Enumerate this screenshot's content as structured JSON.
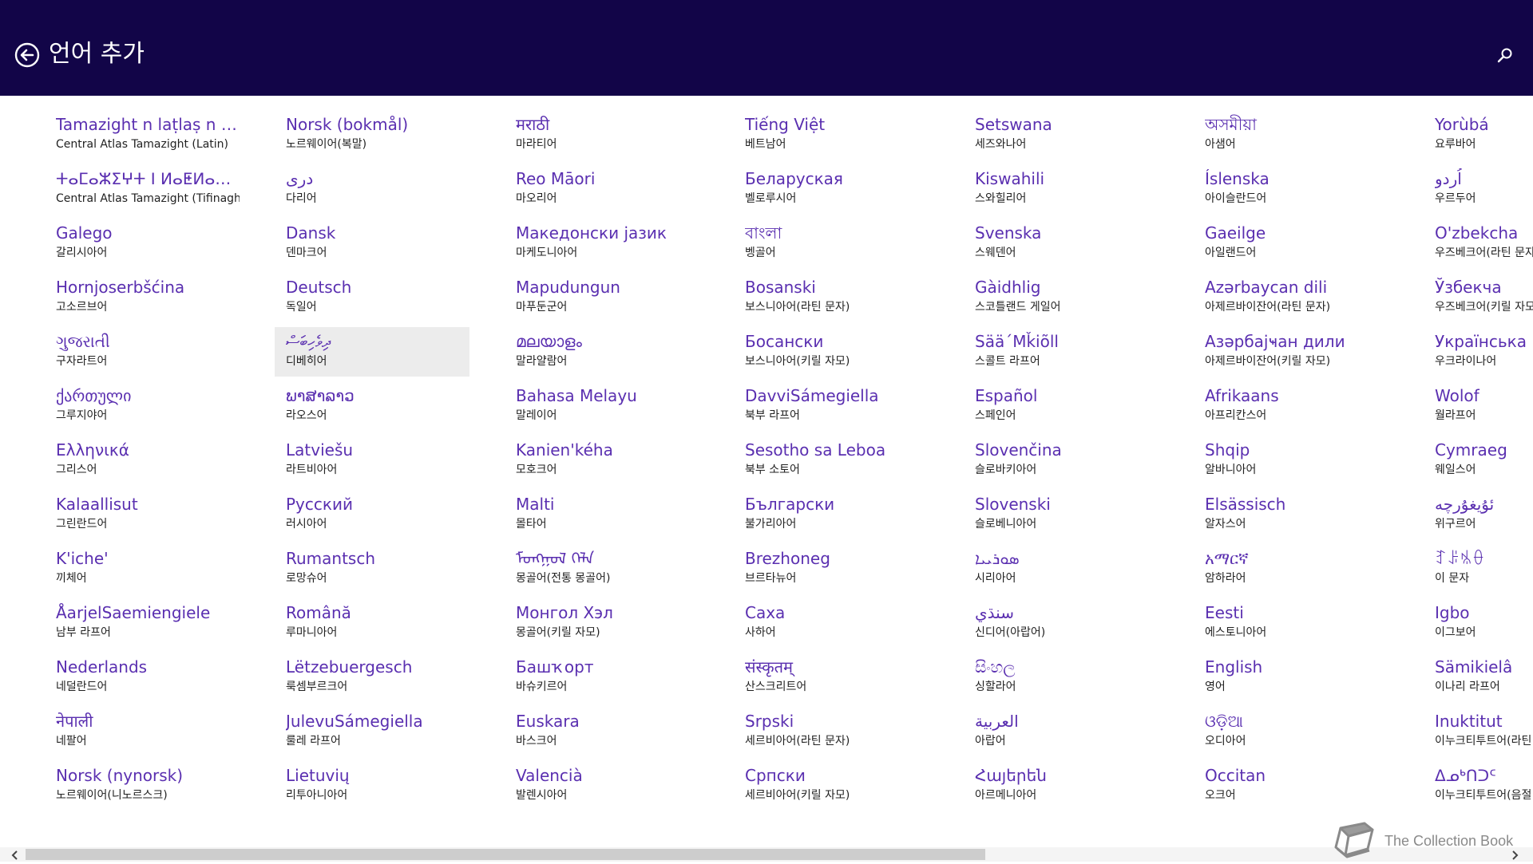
{
  "header": {
    "title": "언어 추가",
    "back_icon": "back-arrow-icon",
    "search_icon": "search-icon",
    "bg_color": "#120548"
  },
  "accent_color": "#5a2fb0",
  "columns": [
    [
      {
        "native": "Tamazight n laṭlaṣ n wa...",
        "korean": "Central Atlas Tamazight (Latin)"
      },
      {
        "native": "ⵜⴰⵎⴰⵣⵉⵖⵜ ⵏ ⵍⴰⵟⵍⴰⵚ ⵏ ⵡⴰ...",
        "korean": "Central Atlas Tamazight (Tifinagh)"
      },
      {
        "native": "Galego",
        "korean": "갈리시아어"
      },
      {
        "native": "Hornjoserbšćina",
        "korean": "고소르브어"
      },
      {
        "native": "ગુજરાતી",
        "korean": "구자라트어"
      },
      {
        "native": "ქართული",
        "korean": "그루지야어"
      },
      {
        "native": "Ελληνικά",
        "korean": "그리스어"
      },
      {
        "native": "Kalaallisut",
        "korean": "그린란드어"
      },
      {
        "native": "K'iche'",
        "korean": "끼체어"
      },
      {
        "native": "ÅarjelSaemiengiele",
        "korean": "남부 라프어"
      },
      {
        "native": "Nederlands",
        "korean": "네덜란드어"
      },
      {
        "native": "नेपाली",
        "korean": "네팔어"
      },
      {
        "native": "Norsk (nynorsk)",
        "korean": "노르웨이어(니노르스크)"
      }
    ],
    [
      {
        "native": "Norsk (bokmål)",
        "korean": "노르웨이어(복말)"
      },
      {
        "native": "دری",
        "korean": "다리어"
      },
      {
        "native": "Dansk",
        "korean": "덴마크어"
      },
      {
        "native": "Deutsch",
        "korean": "독일어"
      },
      {
        "native": "ދިވެހިބަސް",
        "korean": "디베히어",
        "selected": true
      },
      {
        "native": "ພາສາລາວ",
        "korean": "라오스어"
      },
      {
        "native": "Latviešu",
        "korean": "라트비아어"
      },
      {
        "native": "Русский",
        "korean": "러시아어"
      },
      {
        "native": "Rumantsch",
        "korean": "로망슈어"
      },
      {
        "native": "Română",
        "korean": "루마니아어"
      },
      {
        "native": "Lëtzebuergesch",
        "korean": "룩셈부르크어"
      },
      {
        "native": "JulevuSámegiella",
        "korean": "룰레 라프어"
      },
      {
        "native": "Lietuvių",
        "korean": "리투아니아어"
      }
    ],
    [
      {
        "native": "मराठी",
        "korean": "마라티어"
      },
      {
        "native": "Reo Māori",
        "korean": "마오리어"
      },
      {
        "native": "Македонски јазик",
        "korean": "마케도니아어"
      },
      {
        "native": "Mapudungun",
        "korean": "마푸둔군어"
      },
      {
        "native": "മലയാളം",
        "korean": "말라얄람어"
      },
      {
        "native": "Bahasa Melayu",
        "korean": "말레이어"
      },
      {
        "native": "Kanien'kéha",
        "korean": "모호크어"
      },
      {
        "native": "Malti",
        "korean": "몰타어"
      },
      {
        "native": "ᠮᠣᠩᠭᠣᠯ ᠬᠡᠯᠡ",
        "korean": "몽골어(전통 몽골어)"
      },
      {
        "native": "Монгол Хэл",
        "korean": "몽골어(키릴 자모)"
      },
      {
        "native": "Башҡорт",
        "korean": "바슈키르어"
      },
      {
        "native": "Euskara",
        "korean": "바스크어"
      },
      {
        "native": "Valencià",
        "korean": "발렌시아어"
      }
    ],
    [
      {
        "native": "Tiếng Việt",
        "korean": "베트남어"
      },
      {
        "native": "Беларуская",
        "korean": "벨로루시어"
      },
      {
        "native": "বাংলা",
        "korean": "벵골어"
      },
      {
        "native": "Bosanski",
        "korean": "보스니아어(라틴 문자)"
      },
      {
        "native": "Босански",
        "korean": "보스니아어(키릴 자모)"
      },
      {
        "native": "DavviSámegiella",
        "korean": "북부 라프어"
      },
      {
        "native": "Sesotho sa Leboa",
        "korean": "북부 소토어"
      },
      {
        "native": "Български",
        "korean": "불가리아어"
      },
      {
        "native": "Brezhoneg",
        "korean": "브르타뉴어"
      },
      {
        "native": "Саха",
        "korean": "사하어"
      },
      {
        "native": "संस्कृतम्",
        "korean": "산스크리트어"
      },
      {
        "native": "Srpski",
        "korean": "세르비아어(라틴 문자)"
      },
      {
        "native": "Српски",
        "korean": "세르비아어(키릴 자모)"
      }
    ],
    [
      {
        "native": "Setswana",
        "korean": "세즈와나어"
      },
      {
        "native": "Kiswahili",
        "korean": "스와힐리어"
      },
      {
        "native": "Svenska",
        "korean": "스웨덴어"
      },
      {
        "native": "Gàidhlig",
        "korean": "스코틀랜드 게일어"
      },
      {
        "native": "Sää´Mǩiõll",
        "korean": "스콜트 라프어"
      },
      {
        "native": "Español",
        "korean": "스페인어"
      },
      {
        "native": "Slovenčina",
        "korean": "슬로바키아어"
      },
      {
        "native": "Slovenski",
        "korean": "슬로베니아어"
      },
      {
        "native": "ܣܘܪܝܝܐ",
        "korean": "시리아어"
      },
      {
        "native": "سنڌي",
        "korean": "신디어(아랍어)"
      },
      {
        "native": "සිංහල",
        "korean": "싱할라어"
      },
      {
        "native": "العربية",
        "korean": "아랍어"
      },
      {
        "native": "Հայերեն",
        "korean": "아르메니아어"
      }
    ],
    [
      {
        "native": "অসমীয়া",
        "korean": "아샘어"
      },
      {
        "native": "Íslenska",
        "korean": "아이슬란드어"
      },
      {
        "native": "Gaeilge",
        "korean": "아일랜드어"
      },
      {
        "native": "Azərbaycan dili",
        "korean": "아제르바이잔어(라틴 문자)"
      },
      {
        "native": "Азәрбајҹан дили",
        "korean": "아제르바이잔어(키릴 자모)"
      },
      {
        "native": "Afrikaans",
        "korean": "아프리칸스어"
      },
      {
        "native": "Shqip",
        "korean": "알바니아어"
      },
      {
        "native": "Elsässisch",
        "korean": "알자스어"
      },
      {
        "native": "አማርኛ",
        "korean": "암하라어"
      },
      {
        "native": "Eesti",
        "korean": "에스토니아어"
      },
      {
        "native": "English",
        "korean": "영어"
      },
      {
        "native": "ଓଡ଼ିଆ",
        "korean": "오디아어"
      },
      {
        "native": "Occitan",
        "korean": "오크어"
      }
    ],
    [
      {
        "native": "Yorùbá",
        "korean": "요루바어"
      },
      {
        "native": "اُردو",
        "korean": "우르두어"
      },
      {
        "native": "O'zbekcha",
        "korean": "우즈베크어(라틴 문자)"
      },
      {
        "native": "Ўзбекча",
        "korean": "우즈베크어(키릴 자모)"
      },
      {
        "native": "Українська",
        "korean": "우크라이나어"
      },
      {
        "native": "Wolof",
        "korean": "월라프어"
      },
      {
        "native": "Cymraeg",
        "korean": "웨일스어"
      },
      {
        "native": "ئۇيغۇرچە",
        "korean": "위구르어"
      },
      {
        "native": "ꆈꌠꁱꂷ",
        "korean": "이 문자"
      },
      {
        "native": "Igbo",
        "korean": "이그보어"
      },
      {
        "native": "Sämikielâ",
        "korean": "이나리 라프어"
      },
      {
        "native": "Inuktitut",
        "korean": "이누크티투트어(라틴 문자)"
      },
      {
        "native": "ᐃᓄᒃᑎᑐᑦ",
        "korean": "이누크티투트어(음절 문자)"
      }
    ]
  ],
  "scrollbar": {
    "left_icon": "chevron-left-icon",
    "right_icon": "chevron-right-icon"
  },
  "watermark": {
    "text": "The Collection Book",
    "icon": "book-icon"
  }
}
